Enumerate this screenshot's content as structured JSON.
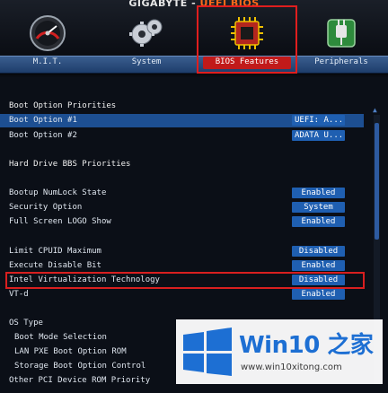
{
  "brand": {
    "left": "GIGABYTE",
    "dash": " - ",
    "right": "UEFI BIOS"
  },
  "tabs": [
    {
      "label": "M.I.T.",
      "icon": "speedometer-icon",
      "active": false
    },
    {
      "label": "System",
      "icon": "gears-icon",
      "active": false
    },
    {
      "label": "BIOS Features",
      "icon": "chip-icon",
      "active": true
    },
    {
      "label": "Peripherals",
      "icon": "plug-icon",
      "active": false
    }
  ],
  "settings": [
    {
      "label": "Boot Option Priorities",
      "value": "",
      "type": "header"
    },
    {
      "label": "Boot Option #1",
      "value": "UEFI: A...",
      "type": "item",
      "selected": true
    },
    {
      "label": "Boot Option #2",
      "value": "ADATA U...",
      "type": "item"
    },
    {
      "label": "Hard Drive BBS Priorities",
      "value": "",
      "type": "header"
    },
    {
      "label": "Bootup NumLock State",
      "value": "Enabled",
      "type": "item"
    },
    {
      "label": "Security Option",
      "value": "System",
      "type": "item"
    },
    {
      "label": "Full Screen LOGO Show",
      "value": "Enabled",
      "type": "item"
    },
    {
      "label": "Limit CPUID Maximum",
      "value": "Disabled",
      "type": "item"
    },
    {
      "label": "Execute Disable Bit",
      "value": "Enabled",
      "type": "item"
    },
    {
      "label": "Intel Virtualization Technology",
      "value": "Disabled",
      "type": "item",
      "highlighted": true
    },
    {
      "label": "VT-d",
      "value": "Enabled",
      "type": "item"
    },
    {
      "label": "OS Type",
      "value": "",
      "type": "header"
    },
    {
      "label": "Boot Mode Selection",
      "value": "",
      "type": "sub"
    },
    {
      "label": "LAN PXE Boot Option ROM",
      "value": "",
      "type": "sub"
    },
    {
      "label": "Storage Boot Option Control",
      "value": "",
      "type": "sub"
    },
    {
      "label": "Other PCI Device ROM Priority",
      "value": "",
      "type": "item"
    }
  ],
  "watermark": {
    "title": "Win10 之家",
    "url": "www.win10xitong.com"
  },
  "colors": {
    "menu_bar": "#2b4f85",
    "value_button": "#1f5fb1",
    "selected_row": "#1d4f92",
    "highlight_frame": "#d81f1f",
    "brand_accent": "#ff6a1a",
    "watermark_blue": "#1d6fd3"
  }
}
